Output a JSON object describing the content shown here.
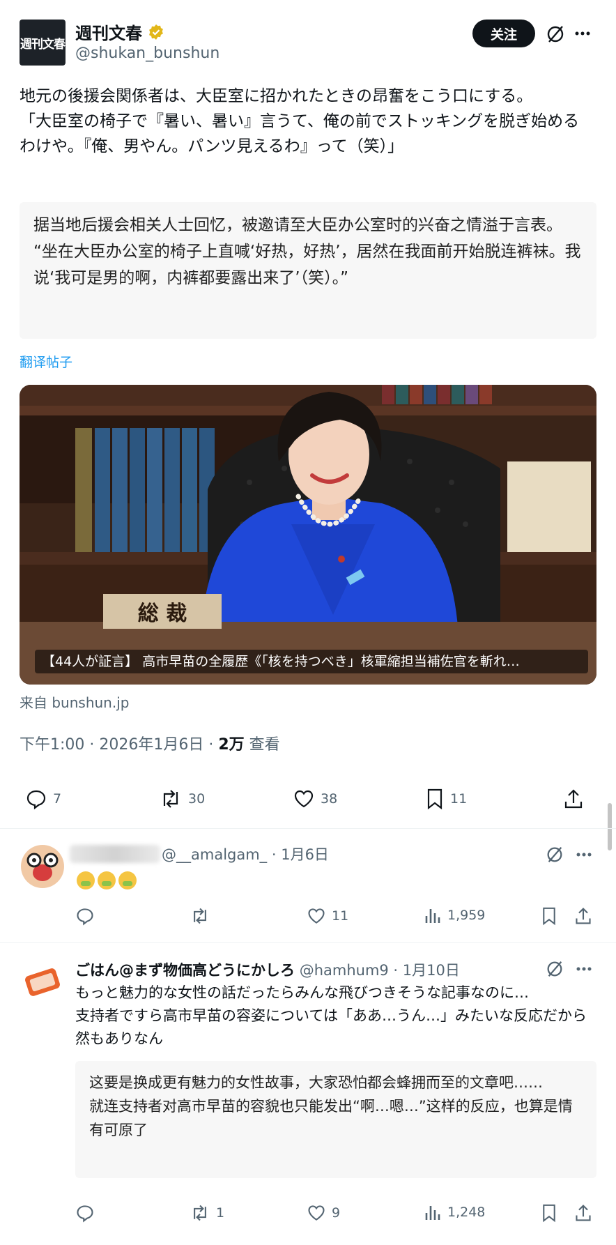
{
  "post": {
    "author_name": "週刊文春",
    "author_handle": "@shukan_bunshun",
    "logo_text": "週刊文春",
    "follow_label": "关注",
    "text": "地元の後援会関係者は、大臣室に招かれたときの昂奮をこう口にする。\n「大臣室の椅子で『暑い、暑い』言うて、俺の前でストッキングを脱ぎ始めるわけや。『俺、男やん。パンツ見えるわ』って（笑）」",
    "translation": "据当地后援会相关人士回忆，被邀请至大臣办公室时的兴奋之情溢于言表。\n“坐在大臣办公室的椅子上直喊‘好热，好热’，居然在我面前开始脱连裤袜。我说‘我可是男的啊，内裤都要露出来了’（笑）。”",
    "translate_label": "翻译帖子",
    "card_caption": "【44人が証言】 高市早苗の全履歴《「核を持つべき」核軍縮担当補佐官を斬れ…",
    "card_desk_sign": "総 裁",
    "source": "来自 bunshun.jp",
    "time": "下午1:00 · 2026年1月6日 · ",
    "views_count": "2万",
    "views_label": " 查看",
    "actions": {
      "replies": "7",
      "reposts": "30",
      "likes": "38",
      "bookmarks": "11"
    }
  },
  "replies": [
    {
      "handle_meta": "@__amalgam_ · 1月6日",
      "text": "",
      "emoji_count": 3,
      "actions": {
        "replies": "",
        "reposts": "",
        "likes": "11",
        "views": "1,959"
      }
    },
    {
      "name": "ごはん@まず物価高どうにかしろ",
      "handle_meta": "@hamhum9 · 1月10日",
      "text": "もっと魅力的な女性の話だったらみんな飛びつきそうな記事なのに…\n支持者ですら高市早苗の容姿については「ああ…うん…」みたいな反応だから然もありなん",
      "translation": "这要是换成更有魅力的女性故事，大家恐怕都会蜂拥而至的文章吧……\n就连支持者对高市早苗的容貌也只能发出“啊…嗯…”这样的反应，也算是情有可原了",
      "actions": {
        "replies": "",
        "reposts": "1",
        "likes": "9",
        "views": "1,248"
      }
    }
  ],
  "colors": {
    "accent": "#1d9bf0",
    "text": "#0f1419",
    "muted": "#536471",
    "jacket": "#1f48d8"
  }
}
